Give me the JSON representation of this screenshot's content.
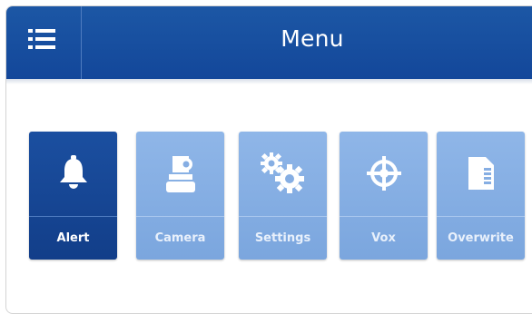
{
  "header": {
    "title": "Menu",
    "menu_icon": "hamburger-icon"
  },
  "tiles": [
    {
      "label": "Alert",
      "icon": "bell-icon",
      "active": true
    },
    {
      "label": "Camera",
      "icon": "camera-icon",
      "active": false
    },
    {
      "label": "Settings",
      "icon": "gears-icon",
      "active": false
    },
    {
      "label": "Vox",
      "icon": "crosshair-icon",
      "active": false
    },
    {
      "label": "Overwrite",
      "icon": "sd-card-icon",
      "active": false
    }
  ],
  "colors": {
    "header": "#1752a2",
    "tile_active": "#17479a",
    "tile_inactive": "#86aee3"
  }
}
